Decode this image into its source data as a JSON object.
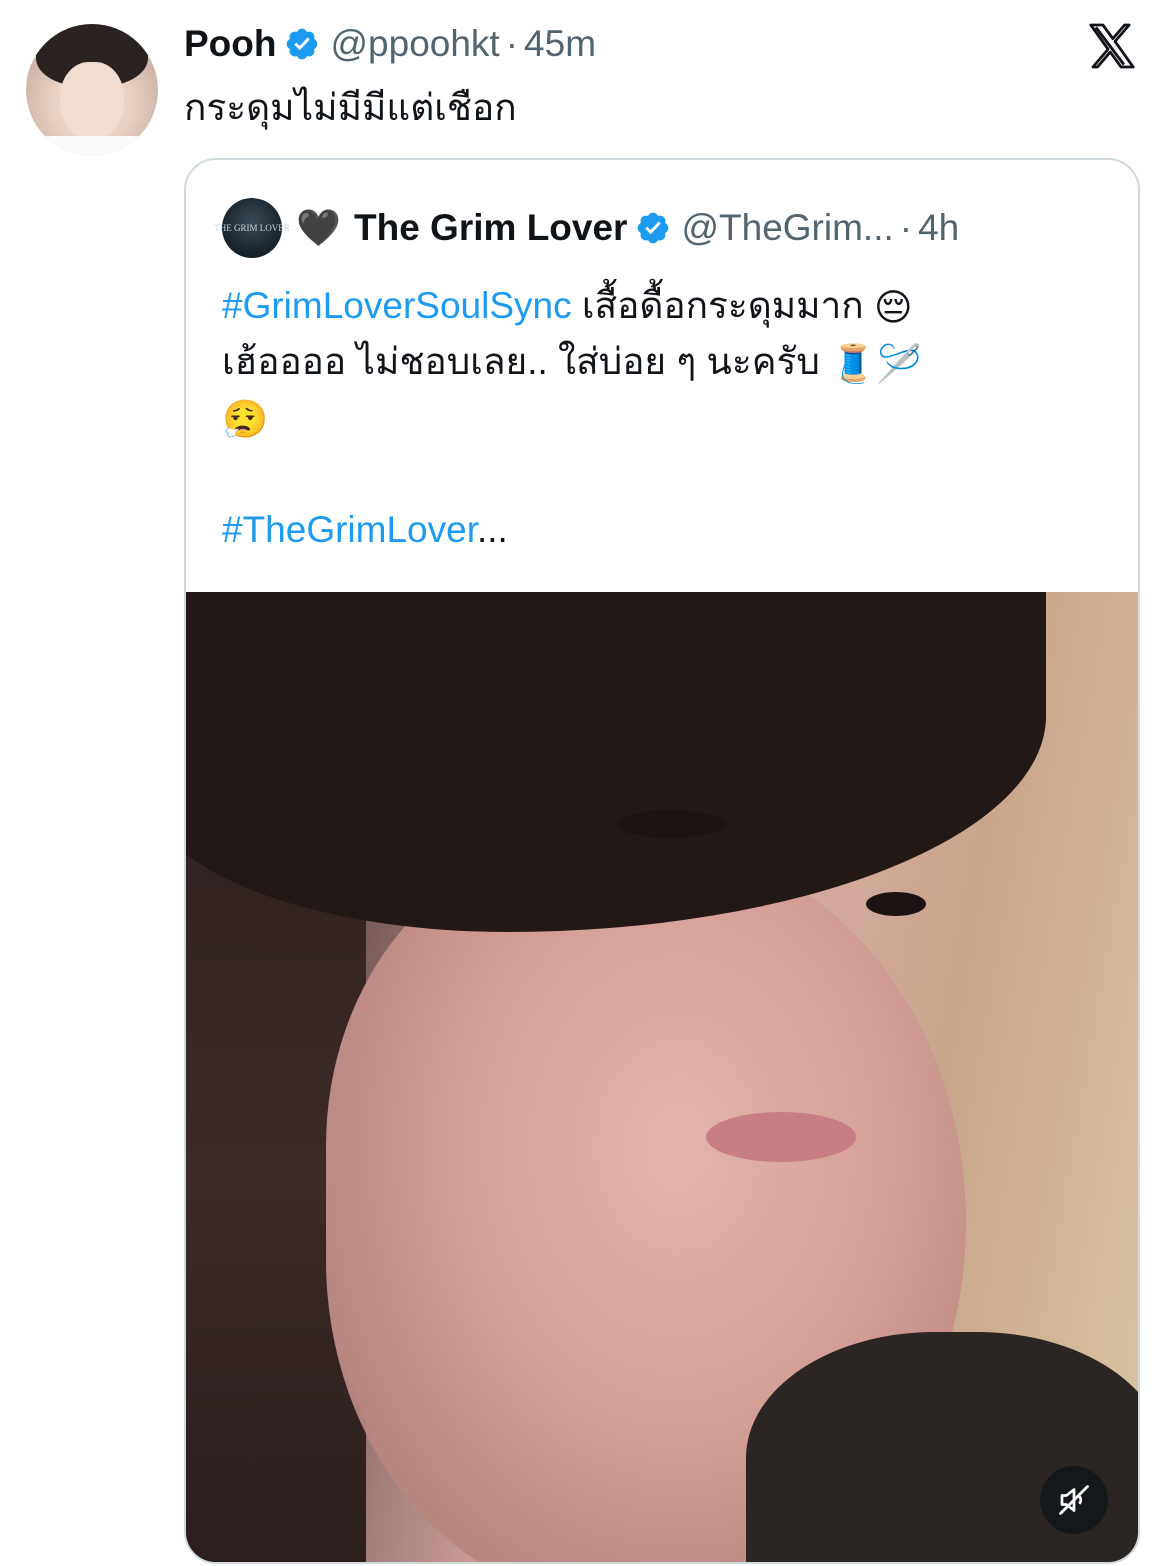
{
  "post": {
    "author_name": "Pooh",
    "author_handle": "@ppoohkt",
    "separator": "·",
    "timestamp": "45m",
    "text": "กระดุมไม่มีมีแต่เชือก"
  },
  "brand": {
    "logo_icon": "x-logo-icon"
  },
  "quote": {
    "avatar_text": "THE GRIM LOVER",
    "heart_emoji": "🖤",
    "author_name": "The Grim Lover",
    "author_handle": "@TheGrim...",
    "separator": "·",
    "timestamp": "4h",
    "line1_hashtag": "#GrimLoverSoulSync",
    "line1_text": " เสื้อดื้อกระดุมมาก ",
    "line1_emoji": "😔",
    "line2_text": "เฮ้ออออ ไม่ชอบเลย.. ใส่บ่อย ๆ นะครับ ",
    "line2_emoji1": "🧵",
    "line2_emoji2": "🪡",
    "line3_emoji": "😮‍💨",
    "line5_hashtag": "#TheGrimLover",
    "line5_ellipsis": "...",
    "media_icon": "muted-speaker-icon"
  },
  "colors": {
    "link": "#1d9bf0",
    "verified": "#1d9bf0",
    "secondary_text": "#536471",
    "border": "#cfd9de"
  }
}
